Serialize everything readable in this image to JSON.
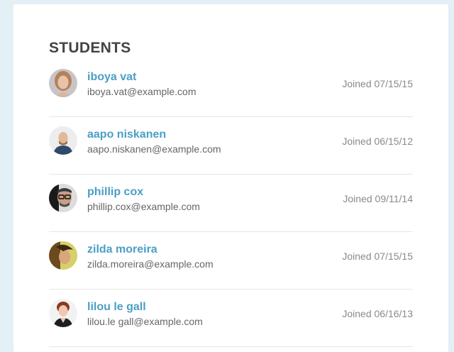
{
  "section": {
    "title": "STUDENTS"
  },
  "students": [
    {
      "name": "iboya vat",
      "email": "iboya.vat@example.com",
      "joined": "Joined 07/15/15",
      "avatar_icon": "avatar-woman-icon"
    },
    {
      "name": "aapo niskanen",
      "email": "aapo.niskanen@example.com",
      "joined": "Joined 06/15/12",
      "avatar_icon": "avatar-man-icon"
    },
    {
      "name": "phillip cox",
      "email": "phillip.cox@example.com",
      "joined": "Joined 09/11/14",
      "avatar_icon": "avatar-man-glasses-icon"
    },
    {
      "name": "zilda moreira",
      "email": "zilda.moreira@example.com",
      "joined": "Joined 07/15/15",
      "avatar_icon": "avatar-woman-icon"
    },
    {
      "name": "lilou le gall",
      "email": "lilou.le gall@example.com",
      "joined": "Joined 06/16/13",
      "avatar_icon": "avatar-woman-icon"
    }
  ],
  "colors": {
    "background": "#e3f0f6",
    "card": "#ffffff",
    "name_link": "#4a9fc4",
    "title": "#444444",
    "email": "#666666",
    "joined": "#8a8a8a",
    "divider": "#e6e6e6"
  }
}
